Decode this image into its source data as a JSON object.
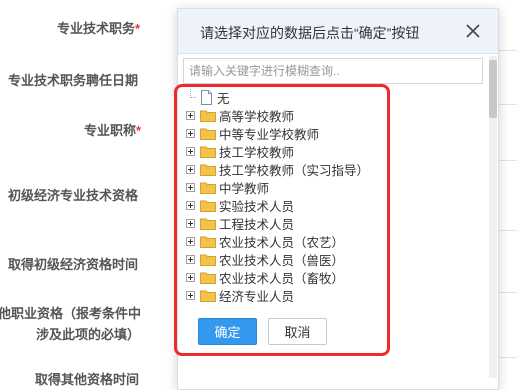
{
  "form": {
    "labels": [
      {
        "text": "专业技术职务",
        "required": true
      },
      {
        "text": "专业技术职务聘任日期",
        "required": false
      },
      {
        "text": "专业职称",
        "required": true
      },
      {
        "text": "初级经济专业技术资格",
        "required": false
      },
      {
        "text": "取得初级经济资格时间",
        "required": false
      },
      {
        "text": "他职业资格（报考条件中",
        "required": false
      },
      {
        "text": "涉及此项的必填）",
        "required": false
      },
      {
        "text": "取得其他资格时间",
        "required": false
      }
    ],
    "required_mark": "*"
  },
  "dialog": {
    "title": "请选择对应的数据后点击“确定”按钮",
    "close_icon": "close-icon",
    "search_placeholder": "请输入关键字进行模糊查询..",
    "tree_items": [
      {
        "label": "无",
        "type": "leaf",
        "icon": "document-icon"
      },
      {
        "label": "高等学校教师",
        "type": "folder",
        "icon": "folder-icon"
      },
      {
        "label": "中等专业学校教师",
        "type": "folder",
        "icon": "folder-icon"
      },
      {
        "label": "技工学校教师",
        "type": "folder",
        "icon": "folder-icon"
      },
      {
        "label": "技工学校教师（实习指导）",
        "type": "folder",
        "icon": "folder-icon"
      },
      {
        "label": "中学教师",
        "type": "folder",
        "icon": "folder-icon"
      },
      {
        "label": "实验技术人员",
        "type": "folder",
        "icon": "folder-icon"
      },
      {
        "label": "工程技术人员",
        "type": "folder",
        "icon": "folder-icon"
      },
      {
        "label": "农业技术人员（农艺）",
        "type": "folder",
        "icon": "folder-icon"
      },
      {
        "label": "农业技术人员（兽医）",
        "type": "folder",
        "icon": "folder-icon"
      },
      {
        "label": "农业技术人员（畜牧）",
        "type": "folder",
        "icon": "folder-icon"
      },
      {
        "label": "经济专业人员",
        "type": "folder",
        "icon": "folder-icon"
      }
    ],
    "ok_label": "确定",
    "cancel_label": "取消"
  },
  "colors": {
    "primary_button": "#3399ee",
    "highlight_border": "#ee2a2a",
    "required_mark": "#ee3333",
    "folder": "#f3c24b"
  }
}
